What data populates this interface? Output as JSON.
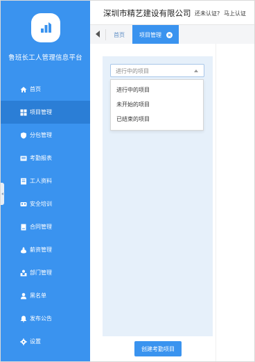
{
  "sidebar": {
    "platform_title": "鲁班长工人管理信息平台",
    "items": [
      {
        "label": "首页",
        "icon": "home-icon",
        "active": false
      },
      {
        "label": "项目管理",
        "icon": "grid-icon",
        "active": true
      },
      {
        "label": "分包管理",
        "icon": "shield-icon",
        "active": false
      },
      {
        "label": "考勤报表",
        "icon": "report-icon",
        "active": false
      },
      {
        "label": "工人资料",
        "icon": "document-icon",
        "active": false
      },
      {
        "label": "安全培训",
        "icon": "training-icon",
        "active": false
      },
      {
        "label": "合同管理",
        "icon": "contract-icon",
        "active": false
      },
      {
        "label": "薪资管理",
        "icon": "salary-icon",
        "active": false
      },
      {
        "label": "部门管理",
        "icon": "department-icon",
        "active": false
      },
      {
        "label": "黑名单",
        "icon": "user-icon",
        "active": false
      },
      {
        "label": "发布公告",
        "icon": "announcement-icon",
        "active": false
      },
      {
        "label": "设置",
        "icon": "gear-icon",
        "active": false
      }
    ]
  },
  "header": {
    "company": "深圳市精艺建设有限公司",
    "cert_status": "还未认证?",
    "cert_link": "马上认证"
  },
  "tabs": {
    "home": "首页",
    "active": "项目管理"
  },
  "main": {
    "select": {
      "placeholder": "进行中的项目",
      "options": [
        "进行中的项目",
        "未开始的项目",
        "已结束的项目"
      ]
    },
    "create_button": "创建考勤项目"
  },
  "colors": {
    "primary": "#3a93ef",
    "sidebar_active": "#2b7ed6",
    "panel": "#e6f0fa"
  }
}
